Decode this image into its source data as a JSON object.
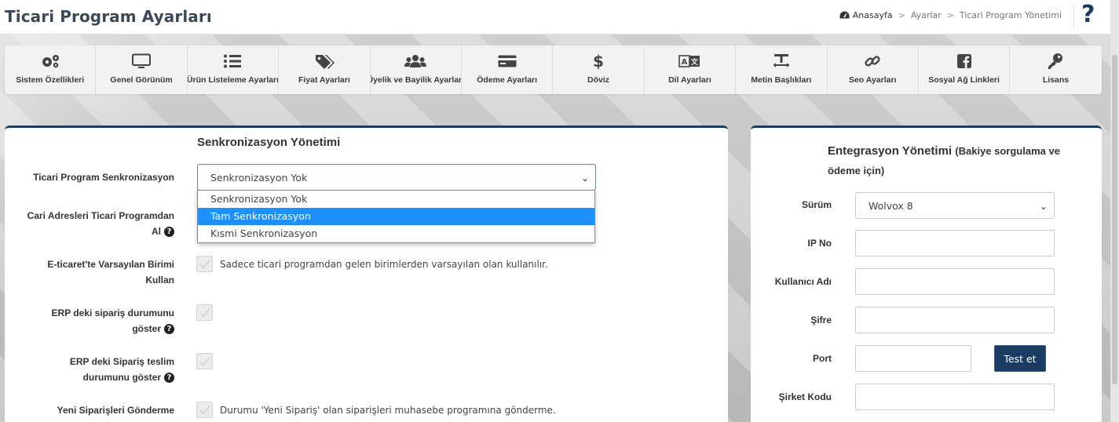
{
  "header": {
    "title": "Ticari Program Ayarları",
    "breadcrumb": [
      "Anasayfa",
      "Ayarlar",
      "Ticari Program Yönetimi"
    ],
    "breadcrumb_sep": ">",
    "help": "?"
  },
  "tabs": [
    {
      "label": "Sistem Özellikleri",
      "icon": "cogs-icon"
    },
    {
      "label": "Genel Görünüm",
      "icon": "monitor-icon"
    },
    {
      "label": "Ürün Listeleme Ayarları",
      "icon": "list-icon"
    },
    {
      "label": "Fiyat Ayarları",
      "icon": "tags-icon"
    },
    {
      "label": "Üyelik ve Bayilik Ayarları",
      "icon": "users-icon"
    },
    {
      "label": "Ödeme Ayarları",
      "icon": "credit-card-icon"
    },
    {
      "label": "Döviz",
      "icon": "dollar-icon"
    },
    {
      "label": "Dil Ayarları",
      "icon": "language-icon"
    },
    {
      "label": "Metin Başlıkları",
      "icon": "text-icon"
    },
    {
      "label": "Seo Ayarları",
      "icon": "link-icon"
    },
    {
      "label": "Sosyal Ağ Linkleri",
      "icon": "facebook-icon"
    },
    {
      "label": "Lisans",
      "icon": "key-icon"
    }
  ],
  "sync": {
    "title": "Senkronizasyon Yönetimi",
    "program_sync_label": "Ticari Program Senkronizasyon",
    "program_sync_value": "Senkronizasyon Yok",
    "program_sync_options": [
      "Senkronizasyon Yok",
      "Tam Senkronizasyon",
      "Kısmi Senkronizasyon"
    ],
    "program_sync_highlighted": "Tam Senkronizasyon",
    "cari_label_line1": "Cari Adresleri Ticari Programdan",
    "cari_label_line2": "Al",
    "unit_label_line1": "E-ticaret'te Varsayılan Birimi",
    "unit_label_line2": "Kullan",
    "unit_text": "Sadece ticari programdan gelen birimlerden varsayılan olan kullanılır.",
    "erp_status_line1": "ERP deki sipariş durumunu",
    "erp_status_line2": "göster",
    "erp_delivery_line1": "ERP deki Sipariş teslim",
    "erp_delivery_line2": "durumunu göster",
    "new_orders_label": "Yeni Siparişleri Gönderme",
    "new_orders_text": "Durumu 'Yeni Sipariş' olan siparişleri muhasebe programına gönderme."
  },
  "integration": {
    "title": "Entegrasyon Yönetimi",
    "subtitle_line1": "(Bakiye sorgulama ve",
    "subtitle_line2": "ödeme için)",
    "version_label": "Sürüm",
    "version_value": "Wolvox 8",
    "ip_label": "IP No",
    "user_label": "Kullanıcı Adı",
    "password_label": "Şifre",
    "port_label": "Port",
    "test_button": "Test et",
    "company_label": "Şirket Kodu"
  },
  "colors": {
    "accent": "#1c3d63",
    "highlight": "#1e90ff"
  }
}
